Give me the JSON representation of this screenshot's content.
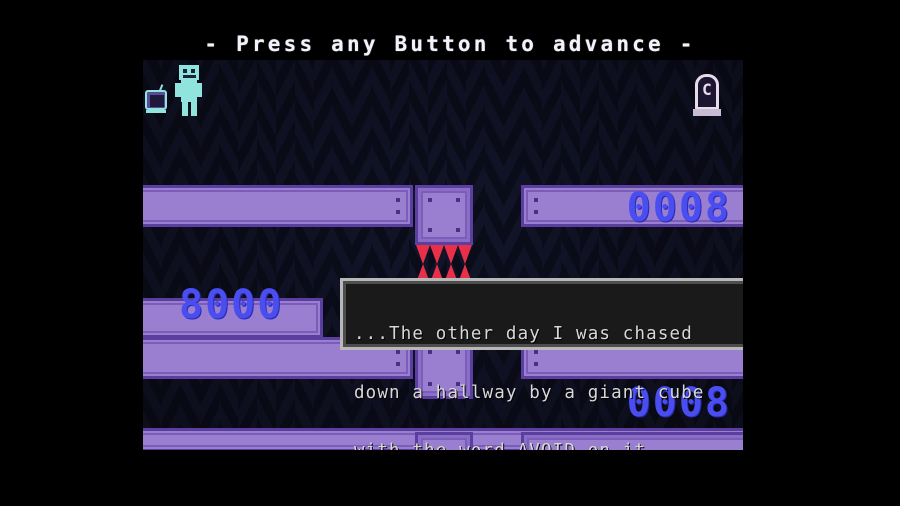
{
  "banner": {
    "prompt": "- Press any Button to advance -"
  },
  "dialogue": {
    "line1": "...The other day I was chased",
    "line2": "down a hallway by a giant cube",
    "line3": "with the word AVOID on it.",
    "full_text": "...The other day I was chased down a hallway by a giant cube with the word AVOID on it."
  },
  "hud": {
    "score_top_right": "0008",
    "score_mid_left": "8000",
    "score_bottom_right": "0008"
  },
  "checkpoint": {
    "letter": "C"
  },
  "colors": {
    "letterbox": "#000000",
    "background_dark": "#0d0f20",
    "background_light": "#151830",
    "platform_face": "#9a7fd0",
    "platform_edge": "#5b3fa0",
    "spike_red": "#e8304a",
    "score_blue": "#4a4ef0",
    "player_cyan": "#8fe4dd",
    "dialogue_border": "#b8b8b8",
    "dialogue_fill": "#1a1a1a",
    "dialogue_text": "#d8d8d8",
    "banner_text": "#f2f2fa"
  }
}
